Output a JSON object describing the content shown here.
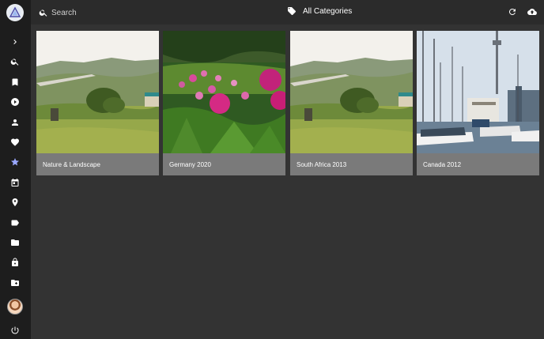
{
  "sidebar": {
    "items": [
      {
        "name": "expand-icon"
      },
      {
        "name": "search-icon"
      },
      {
        "name": "bookmark-icon"
      },
      {
        "name": "play-icon"
      },
      {
        "name": "person-icon"
      },
      {
        "name": "heart-icon"
      },
      {
        "name": "star-icon"
      },
      {
        "name": "calendar-icon"
      },
      {
        "name": "location-pin-icon"
      },
      {
        "name": "label-icon"
      },
      {
        "name": "folder-icon"
      },
      {
        "name": "lock-icon"
      },
      {
        "name": "folder-special-icon"
      },
      {
        "name": "power-icon"
      }
    ]
  },
  "header": {
    "search_placeholder": "Search",
    "category_label": "All Categories"
  },
  "albums": [
    {
      "title": "Nature & Landscape"
    },
    {
      "title": "Germany 2020"
    },
    {
      "title": "South Africa 2013"
    },
    {
      "title": "Canada 2012"
    }
  ]
}
